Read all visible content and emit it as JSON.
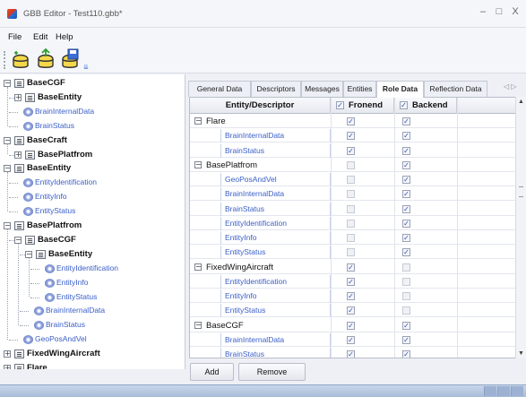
{
  "window": {
    "title": "GBB Editor - Test110.gbb*",
    "minimize": "–",
    "restore": "□",
    "close": "X"
  },
  "menu": {
    "file": "File",
    "edit": "Edit",
    "help": "Help"
  },
  "toolbar": {
    "buttons": [
      "new-icon",
      "open-icon",
      "save-icon"
    ],
    "overflow": "⇊"
  },
  "tree": [
    {
      "label": "BaseCGF",
      "kind": "group",
      "depth": 0,
      "expander": "⊟"
    },
    {
      "label": "BaseEntity",
      "kind": "group",
      "depth": 1,
      "expander": "⊞"
    },
    {
      "label": "BrainInternalData",
      "kind": "entity",
      "depth": 1
    },
    {
      "label": "BrainStatus",
      "kind": "entity",
      "depth": 1
    },
    {
      "label": "BaseCraft",
      "kind": "group",
      "depth": 0,
      "expander": "⊟"
    },
    {
      "label": "BasePlatfrom",
      "kind": "group",
      "depth": 1,
      "expander": "⊞"
    },
    {
      "label": "BaseEntity",
      "kind": "group",
      "depth": 0,
      "expander": "⊟"
    },
    {
      "label": "EntityIdentification",
      "kind": "entity",
      "depth": 1
    },
    {
      "label": "EntityInfo",
      "kind": "entity",
      "depth": 1
    },
    {
      "label": "EntityStatus",
      "kind": "entity",
      "depth": 1
    },
    {
      "label": "BasePlatfrom",
      "kind": "group",
      "depth": 0,
      "expander": "⊟"
    },
    {
      "label": "BaseCGF",
      "kind": "group",
      "depth": 1,
      "expander": "⊟"
    },
    {
      "label": "BaseEntity",
      "kind": "group",
      "depth": 2,
      "expander": "⊟"
    },
    {
      "label": "EntityIdentification",
      "kind": "entity",
      "depth": 3
    },
    {
      "label": "EntityInfo",
      "kind": "entity",
      "depth": 3
    },
    {
      "label": "EntityStatus",
      "kind": "entity",
      "depth": 3
    },
    {
      "label": "BrainInternalData",
      "kind": "entity",
      "depth": 2
    },
    {
      "label": "BrainStatus",
      "kind": "entity",
      "depth": 2
    },
    {
      "label": "GeoPosAndVel",
      "kind": "entity",
      "depth": 1
    },
    {
      "label": "FixedWingAircraft",
      "kind": "group",
      "depth": 0,
      "expander": "⊞"
    },
    {
      "label": "Flare",
      "kind": "group",
      "depth": 0,
      "expander": "⊞"
    }
  ],
  "tabs": [
    {
      "label": "General Data",
      "active": false
    },
    {
      "label": "Descriptors",
      "active": false
    },
    {
      "label": "Messages",
      "active": false
    },
    {
      "label": "Entities",
      "active": false
    },
    {
      "label": "Role Data",
      "active": true
    },
    {
      "label": "Reflection Data",
      "active": false
    }
  ],
  "tab_arrows": "◁ ▷",
  "grid": {
    "headers": {
      "entity": "Entity/Descriptor",
      "frontend": "Fronend",
      "backend": "Backend"
    },
    "rows": [
      {
        "name": "Flare",
        "kind": "group",
        "frontend": true,
        "backend": true
      },
      {
        "name": "BrainInternalData",
        "kind": "entity",
        "frontend": true,
        "backend": true
      },
      {
        "name": "BrainStatus",
        "kind": "entity",
        "frontend": true,
        "backend": true
      },
      {
        "name": "BasePlatfrom",
        "kind": "group",
        "frontend": false,
        "backend": true
      },
      {
        "name": "GeoPosAndVel",
        "kind": "entity",
        "frontend": false,
        "backend": true
      },
      {
        "name": "BrainInternalData",
        "kind": "entity",
        "frontend": false,
        "backend": true
      },
      {
        "name": "BrainStatus",
        "kind": "entity",
        "frontend": false,
        "backend": true
      },
      {
        "name": "EntityIdentification",
        "kind": "entity",
        "frontend": false,
        "backend": true
      },
      {
        "name": "EntityInfo",
        "kind": "entity",
        "frontend": false,
        "backend": true
      },
      {
        "name": "EntityStatus",
        "kind": "entity",
        "frontend": false,
        "backend": true
      },
      {
        "name": "FixedWingAircraft",
        "kind": "group",
        "frontend": true,
        "backend": false
      },
      {
        "name": "EntityIdentification",
        "kind": "entity",
        "frontend": true,
        "backend": false
      },
      {
        "name": "EntityInfo",
        "kind": "entity",
        "frontend": true,
        "backend": false
      },
      {
        "name": "EntityStatus",
        "kind": "entity",
        "frontend": true,
        "backend": false
      },
      {
        "name": "BaseCGF",
        "kind": "group",
        "frontend": true,
        "backend": true
      },
      {
        "name": "BrainInternalData",
        "kind": "entity",
        "frontend": true,
        "backend": true
      },
      {
        "name": "BrainStatus",
        "kind": "entity",
        "frontend": true,
        "backend": true
      }
    ]
  },
  "buttons": {
    "add": "Add",
    "remove": "Remove"
  },
  "colors": {
    "link": "#3a5ec8",
    "status_bar": "#a8bcd8",
    "check": "#2f4eb0"
  }
}
